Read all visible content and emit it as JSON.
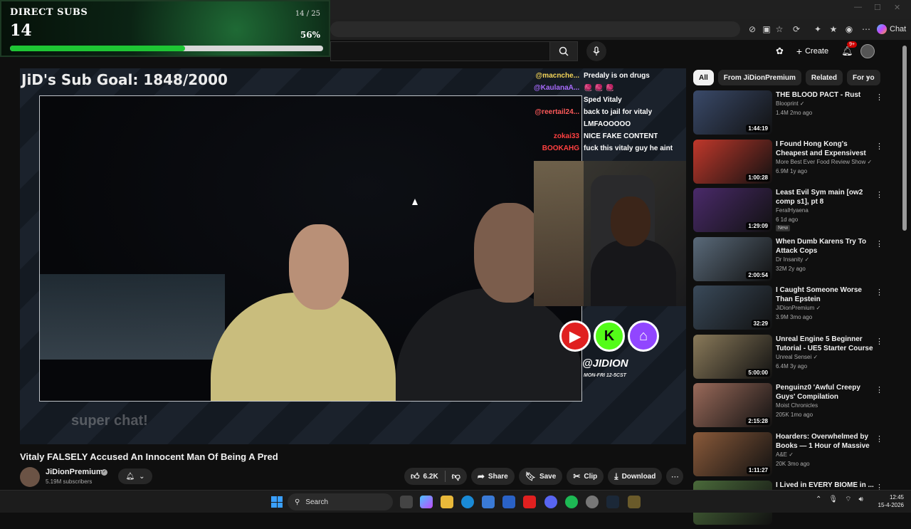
{
  "overlay": {
    "label": "DIRECT SUBS",
    "count": "14",
    "fraction": "14 / 25",
    "percent_text": "56%",
    "progress": 0.56
  },
  "browser": {
    "chat_label": "Chat"
  },
  "youtube_header": {
    "create_label": "Create",
    "notif_badge": "9+"
  },
  "player": {
    "goal_title": "JiD's Sub Goal: 1848/2000",
    "super_chat": "super chat!",
    "handle": "@JIDION",
    "schedule": "MON-FRI 12-5CST",
    "chat": [
      {
        "user": "@macnche...",
        "msg": "Predaly is on drugs",
        "color": "#f5d65a"
      },
      {
        "user": "@KaulanaA...",
        "msg": "🧶 🧶 🧶",
        "color": "#a86bff"
      },
      {
        "user": "",
        "msg": "Sped Vitaly",
        "color": "#3a6bff"
      },
      {
        "user": "@reertail24...",
        "msg": "back to jail for vitaly",
        "color": "#ff5a5a"
      },
      {
        "user": "",
        "msg": "LMFAOOOOO",
        "color": "#ff5a5a"
      },
      {
        "user": "zokai33",
        "msg": "NICE FAKE CONTENT",
        "color": "#ff4040"
      },
      {
        "user": "BOOKAHG",
        "msg": "fuck this vitaly guy he aint",
        "color": "#ff4040"
      }
    ]
  },
  "video": {
    "title": "Vitaly FALSELY Accused An Innocent Man Of Being A Pred",
    "channel": "JiDionPremium",
    "subscribers": "5.19M subscribers",
    "likes": "6.2K",
    "share": "Share",
    "save": "Save",
    "clip": "Clip",
    "download": "Download"
  },
  "chips": [
    "All",
    "From JiDionPremium",
    "Related",
    "For yo"
  ],
  "recommendations": [
    {
      "title": "THE BLOOD PACT - Rust",
      "channel": "Blooprint",
      "verified": true,
      "meta": "1.4M  2mo ago",
      "duration": "1:44:19",
      "thumb_color": "#3a4a6a",
      "badge": ""
    },
    {
      "title": "I Found Hong Kong's Cheapest and Expensivest Street Food!!",
      "channel": "More Best Ever Food Review Show",
      "verified": true,
      "meta": "6.9M  1y ago",
      "duration": "1:00:28",
      "thumb_color": "#c0382b",
      "badge": ""
    },
    {
      "title": "Least Evil Sym main [ow2 comp s1], pt 8",
      "channel": "FeralHyaena",
      "verified": false,
      "meta": "6  1d ago",
      "duration": "1:29:09",
      "thumb_color": "#4a2a6a",
      "badge": "New"
    },
    {
      "title": "When Dumb Karens Try To Attack Cops",
      "channel": "Dr Insanity",
      "verified": true,
      "meta": "32M  2y ago",
      "duration": "2:00:54",
      "thumb_color": "#5a6a7a",
      "badge": ""
    },
    {
      "title": "I Caught Someone Worse Than Epstein",
      "channel": "JiDionPremium",
      "verified": true,
      "meta": "3.9M  3mo ago",
      "duration": "32:29",
      "thumb_color": "#3a4a5a",
      "badge": ""
    },
    {
      "title": "Unreal Engine 5 Beginner Tutorial - UE5 Starter Course",
      "channel": "Unreal Sensei",
      "verified": true,
      "meta": "6.4M  3y ago",
      "duration": "5:00:00",
      "thumb_color": "#8a7a5a",
      "badge": ""
    },
    {
      "title": "Penguinz0 'Awful Creepy Guys' Compilation",
      "channel": "Moist Chronicles",
      "verified": false,
      "meta": "205K  1mo ago",
      "duration": "2:15:28",
      "thumb_color": "#9a6a5a",
      "badge": ""
    },
    {
      "title": "Hoarders: Overwhelmed by Books — 1 Hour of Massive ...",
      "channel": "A&E",
      "verified": true,
      "meta": "20K  3mo ago",
      "duration": "1:11:27",
      "thumb_color": "#8a5a3a",
      "badge": ""
    },
    {
      "title": "I Lived in EVERY BIOME in ...",
      "channel": "",
      "verified": false,
      "meta": "",
      "duration": "",
      "thumb_color": "#4a6a3a",
      "badge": ""
    }
  ],
  "taskbar": {
    "search_label": "Search",
    "time": "12:45",
    "date": "15-4-2026"
  }
}
